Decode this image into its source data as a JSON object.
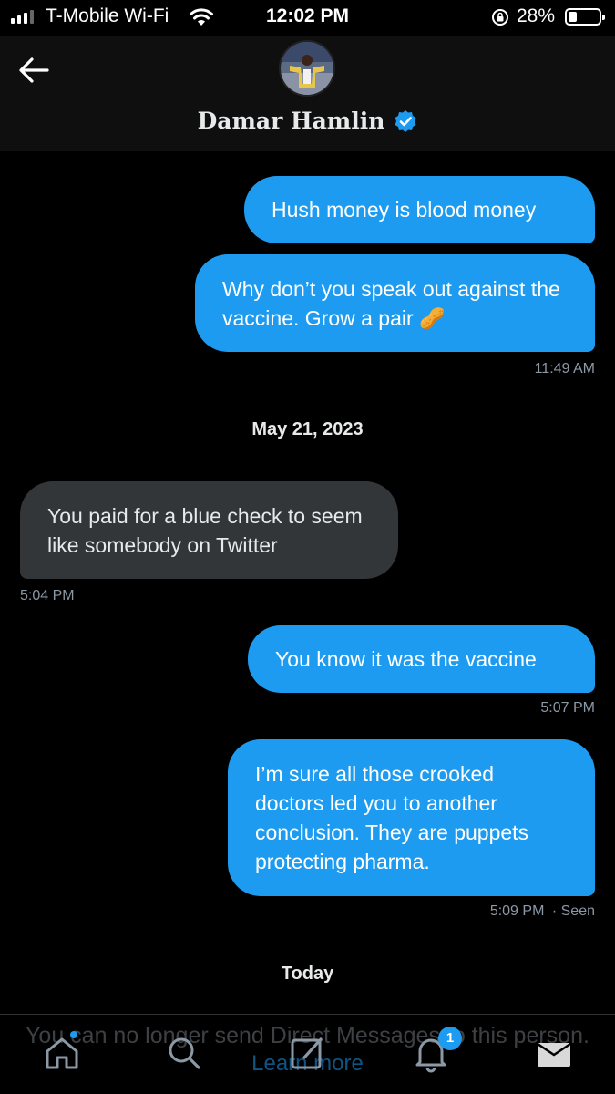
{
  "status_bar": {
    "carrier": "T-Mobile Wi-Fi",
    "time": "12:02 PM",
    "battery": "28%"
  },
  "header": {
    "name": "Damar Hamlin",
    "verified": true
  },
  "messages": [
    {
      "text": "Hush money is blood money",
      "direction": "out"
    },
    {
      "text": "Why don’t you speak out against the vaccine. Grow a pair 🥜",
      "direction": "out",
      "time": "11:49 AM"
    },
    {
      "date_divider": "May 21, 2023"
    },
    {
      "text": "You paid for a blue check to seem like somebody on Twitter",
      "direction": "in",
      "time": "5:04 PM"
    },
    {
      "text": "You know it was the vaccine",
      "direction": "out",
      "time": "5:07 PM"
    },
    {
      "text": "I’m sure all those crooked doctors led you to another conclusion. They are puppets protecting pharma.",
      "direction": "out",
      "time": "5:09 PM",
      "status": "· Seen"
    },
    {
      "date_divider": "Today"
    }
  ],
  "footer": {
    "notice": "You can no longer send Direct Messages to this person.",
    "learn_more": "Learn more"
  },
  "tab_bar": {
    "items": [
      "home-icon",
      "search-icon",
      "compose-icon",
      "bell-icon",
      "mail-icon"
    ],
    "notification_count": "1"
  },
  "colors": {
    "accent": "#1d9bf0",
    "incoming_bubble": "#333639",
    "background": "#000000"
  }
}
